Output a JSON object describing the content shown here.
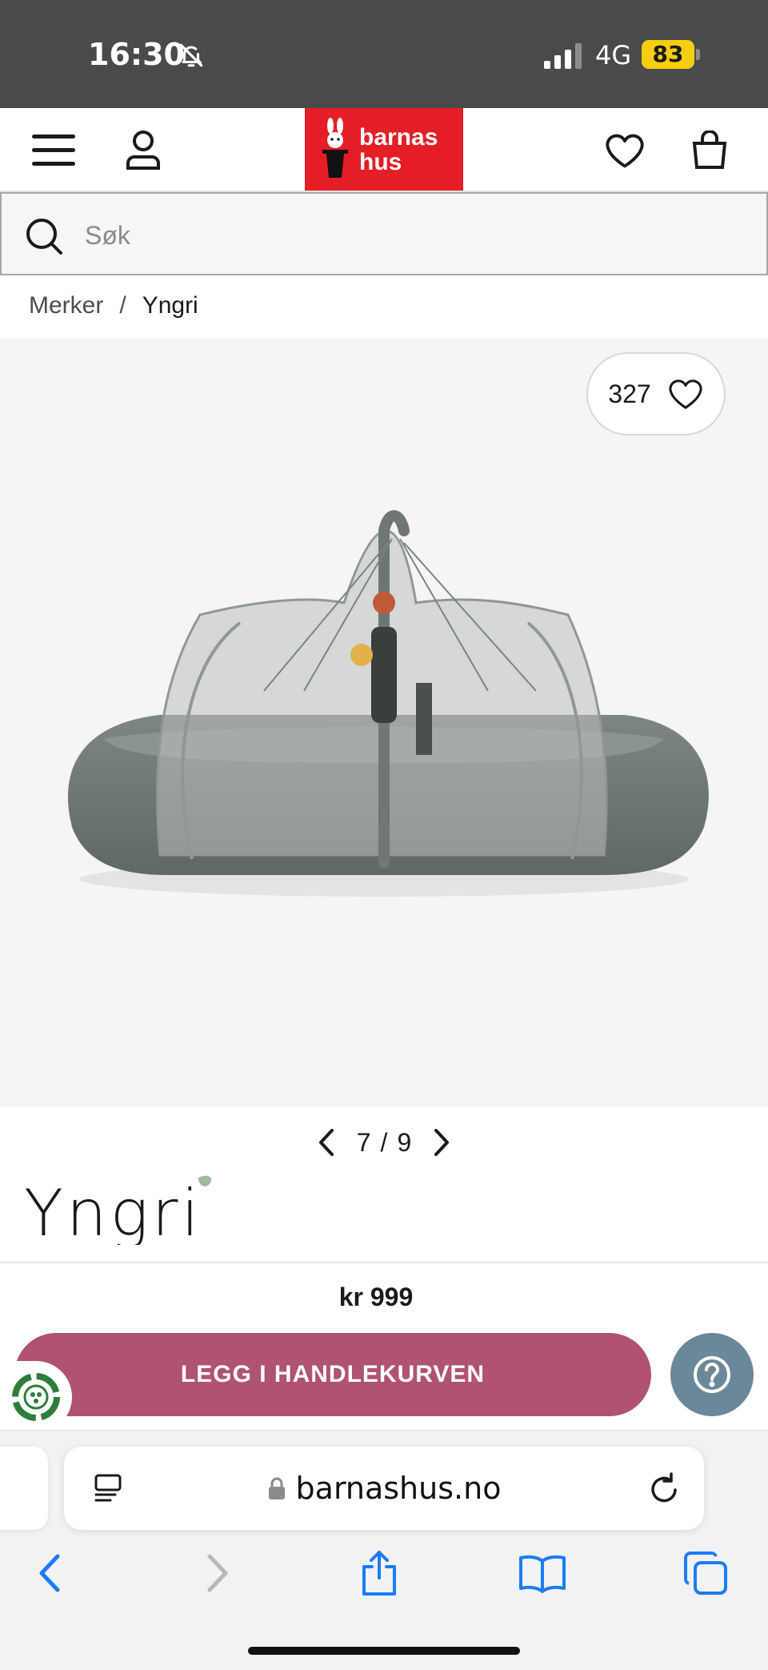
{
  "status_bar": {
    "time": "16:30",
    "network": "4G",
    "battery": "83"
  },
  "header": {
    "logo_line1": "barnas",
    "logo_line2": "hus",
    "menu_icon": "hamburger-icon",
    "account_icon": "user-icon",
    "wishlist_icon": "heart-icon",
    "cart_icon": "shopping-bag-icon"
  },
  "search": {
    "placeholder": "Søk",
    "value": ""
  },
  "breadcrumb": {
    "items": [
      "Merker",
      "Yngri"
    ],
    "separator": "/"
  },
  "gallery": {
    "wishlist_count": "327",
    "current": "7",
    "separator": "/",
    "total": "9"
  },
  "product": {
    "brand": "Yngri",
    "price": "kr 999"
  },
  "actions": {
    "add_to_cart": "LEGG I HANDLEKURVEN",
    "help_icon": "question-icon",
    "eco_icon": "recycle-badge-icon"
  },
  "browser": {
    "url": "barnashus.no"
  },
  "colors": {
    "brand_red": "#e31e24",
    "cart_button": "#b05272",
    "help_button": "#6b8899",
    "status_bar": "#4a4a4a",
    "ios_blue": "#1a7cf5"
  }
}
